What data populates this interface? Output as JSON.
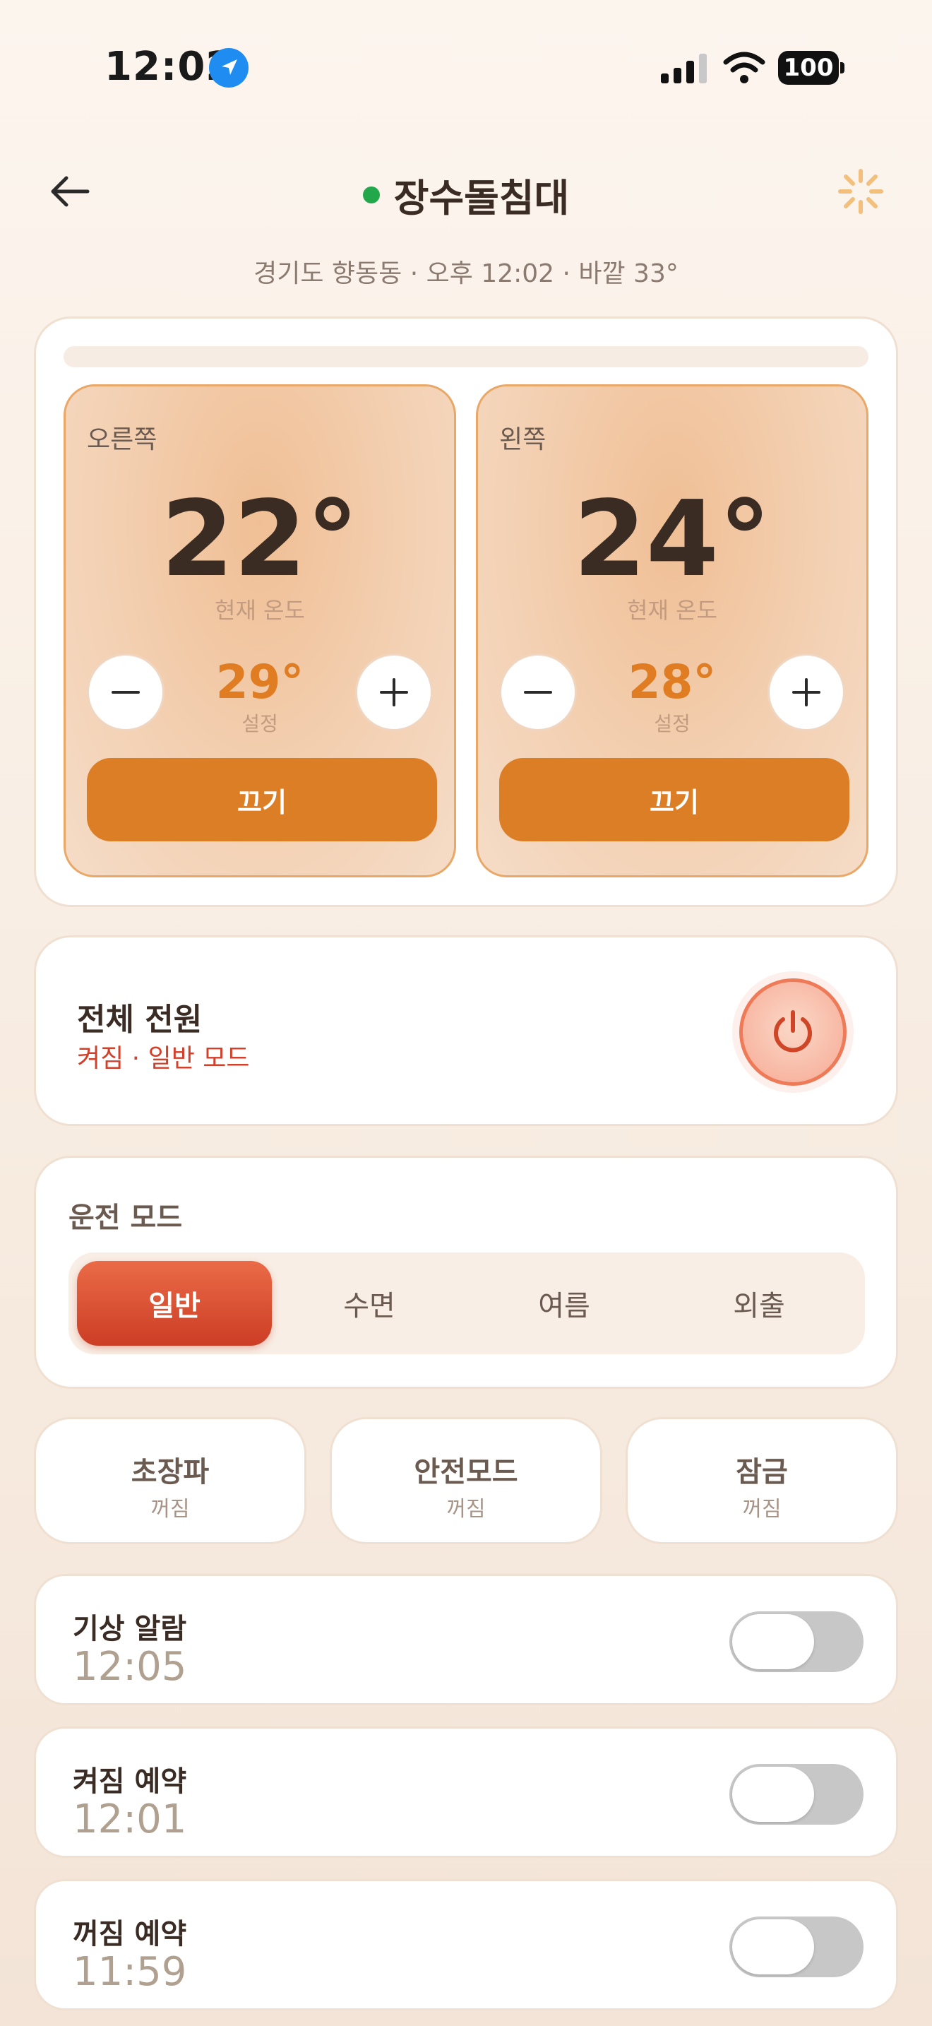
{
  "status_bar": {
    "time": "12:02",
    "battery": "100"
  },
  "header": {
    "title": "장수돌침대",
    "subtitle": "경기도 향동동 · 오후 12:02 · 바깥 33°"
  },
  "zones": [
    {
      "label": "오른쪽",
      "current_temp": "22°",
      "current_caption": "현재 온도",
      "set_temp": "29°",
      "set_caption": "설정",
      "off_label": "끄기"
    },
    {
      "label": "왼쪽",
      "current_temp": "24°",
      "current_caption": "현재 온도",
      "set_temp": "28°",
      "set_caption": "설정",
      "off_label": "끄기"
    }
  ],
  "power": {
    "title": "전체 전원",
    "status": "켜짐 · 일반 모드"
  },
  "mode": {
    "title": "운전 모드",
    "options": [
      "일반",
      "수면",
      "여름",
      "외출"
    ],
    "selected": "일반"
  },
  "features": [
    {
      "title": "초장파",
      "status": "꺼짐"
    },
    {
      "title": "안전모드",
      "status": "꺼짐"
    },
    {
      "title": "잠금",
      "status": "꺼짐"
    }
  ],
  "schedules": [
    {
      "title": "기상 알람",
      "time": "12:05",
      "enabled": false
    },
    {
      "title": "켜짐 예약",
      "time": "12:01",
      "enabled": false
    },
    {
      "title": "꺼짐 예약",
      "time": "11:59",
      "enabled": false
    }
  ],
  "colors": {
    "accent": "#dc7e26",
    "power_accent": "#ee7a58",
    "status_red": "#d1402a",
    "online_green": "#22a84a"
  }
}
